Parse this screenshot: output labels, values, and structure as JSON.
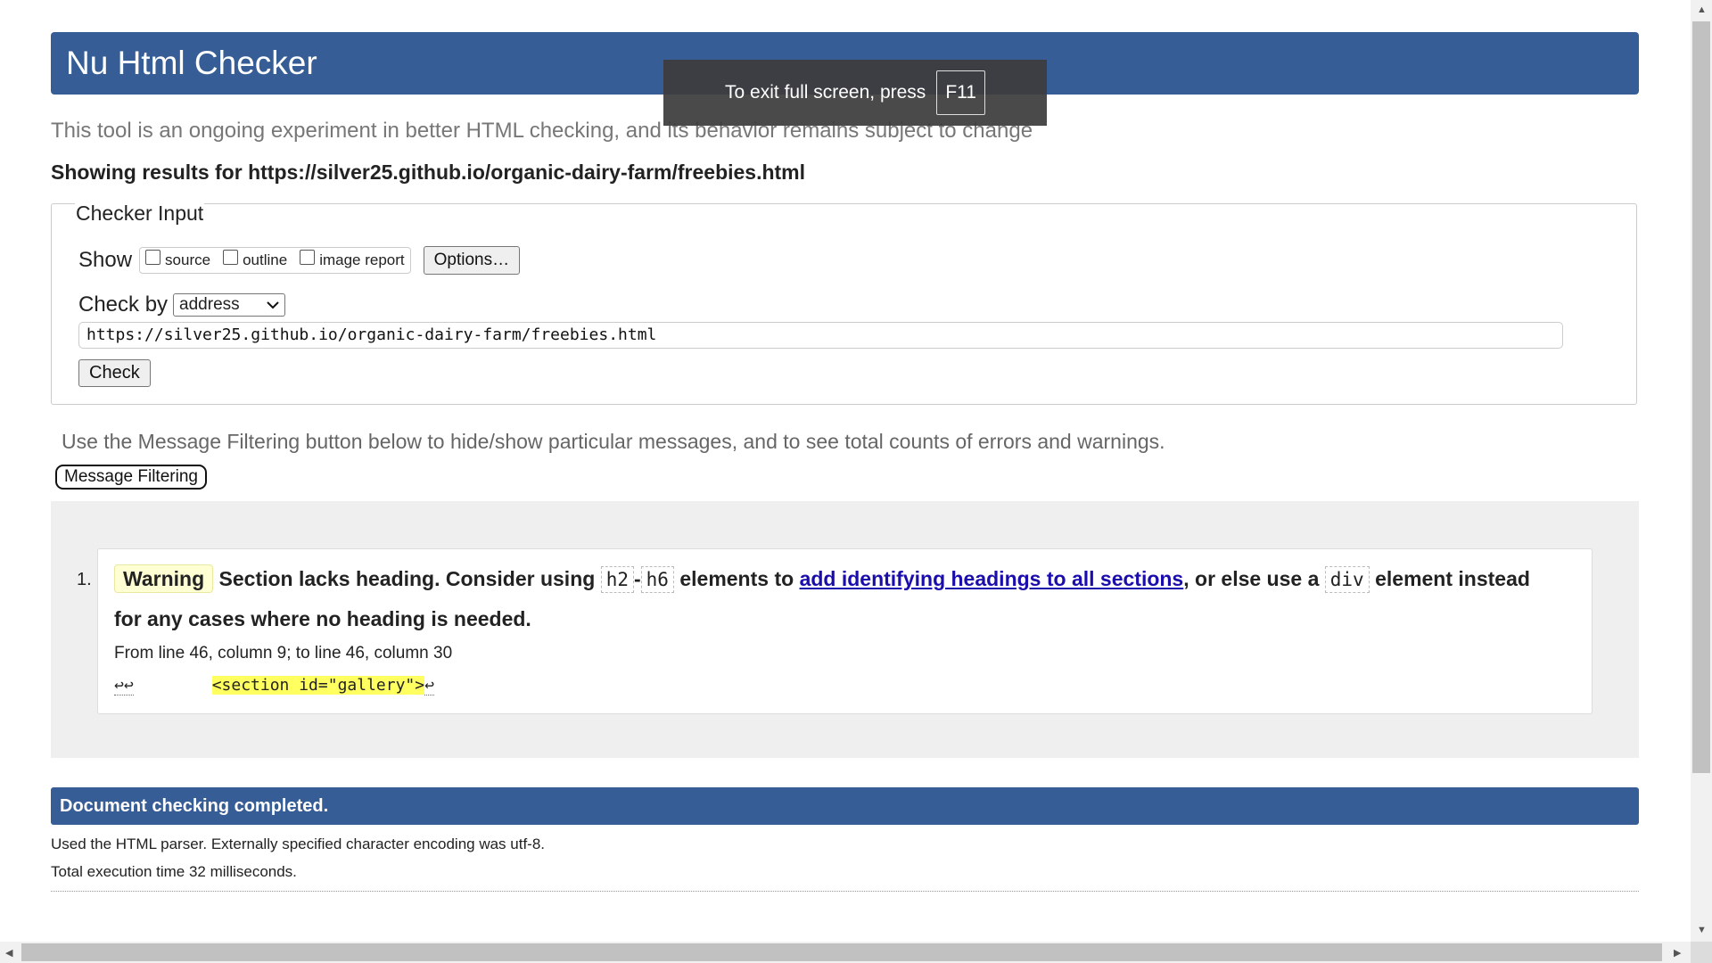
{
  "header": {
    "title": "Nu Html Checker"
  },
  "intro": "This tool is an ongoing experiment in better HTML checking, and its behavior remains subject to change",
  "results_for": "Showing results for https://silver25.github.io/organic-dairy-farm/freebies.html",
  "checker_input": {
    "legend": "Checker Input",
    "show_label": "Show",
    "options": [
      "source",
      "outline",
      "image report"
    ],
    "options_button": "Options…",
    "check_by_label": "Check by",
    "check_by_value": "address",
    "url_value": "https://silver25.github.io/organic-dairy-farm/freebies.html",
    "check_button": "Check"
  },
  "filter": {
    "help": "Use the Message Filtering button below to hide/show particular messages, and to see total counts of errors and warnings.",
    "button": "Message Filtering"
  },
  "message": {
    "number": "1.",
    "type": "Warning",
    "text_1": "Section lacks heading. Consider using",
    "code_1": "h2",
    "dash": "-",
    "code_2": "h6",
    "text_2": "elements to",
    "link": "add identifying headings to all sections",
    "text_3": ", or else use a",
    "code_3": "div",
    "text_4": "element instead for any cases where no heading is needed.",
    "location": "From line 46, column 9; to line 46, column 30",
    "extract_prefix": "↩↩",
    "extract_highlight": "<section id=\"gallery\">",
    "extract_suffix": "↩"
  },
  "completed": "Document checking completed.",
  "parser_note": "Used the HTML parser. Externally specified character encoding was utf-8.",
  "exec_time": "Total execution time 32 milliseconds.",
  "toast": {
    "text": "To exit full screen, press",
    "key": "F11"
  },
  "icons": {
    "select_chevron": "chevron-down-icon",
    "scroll_up": "▲",
    "scroll_down": "▼",
    "scroll_left": "◀",
    "scroll_right": "▶"
  },
  "colors": {
    "banner": "#365d95",
    "warning_badge": "#ffffd4",
    "highlight": "#ffff60",
    "link": "#1a0dab"
  }
}
